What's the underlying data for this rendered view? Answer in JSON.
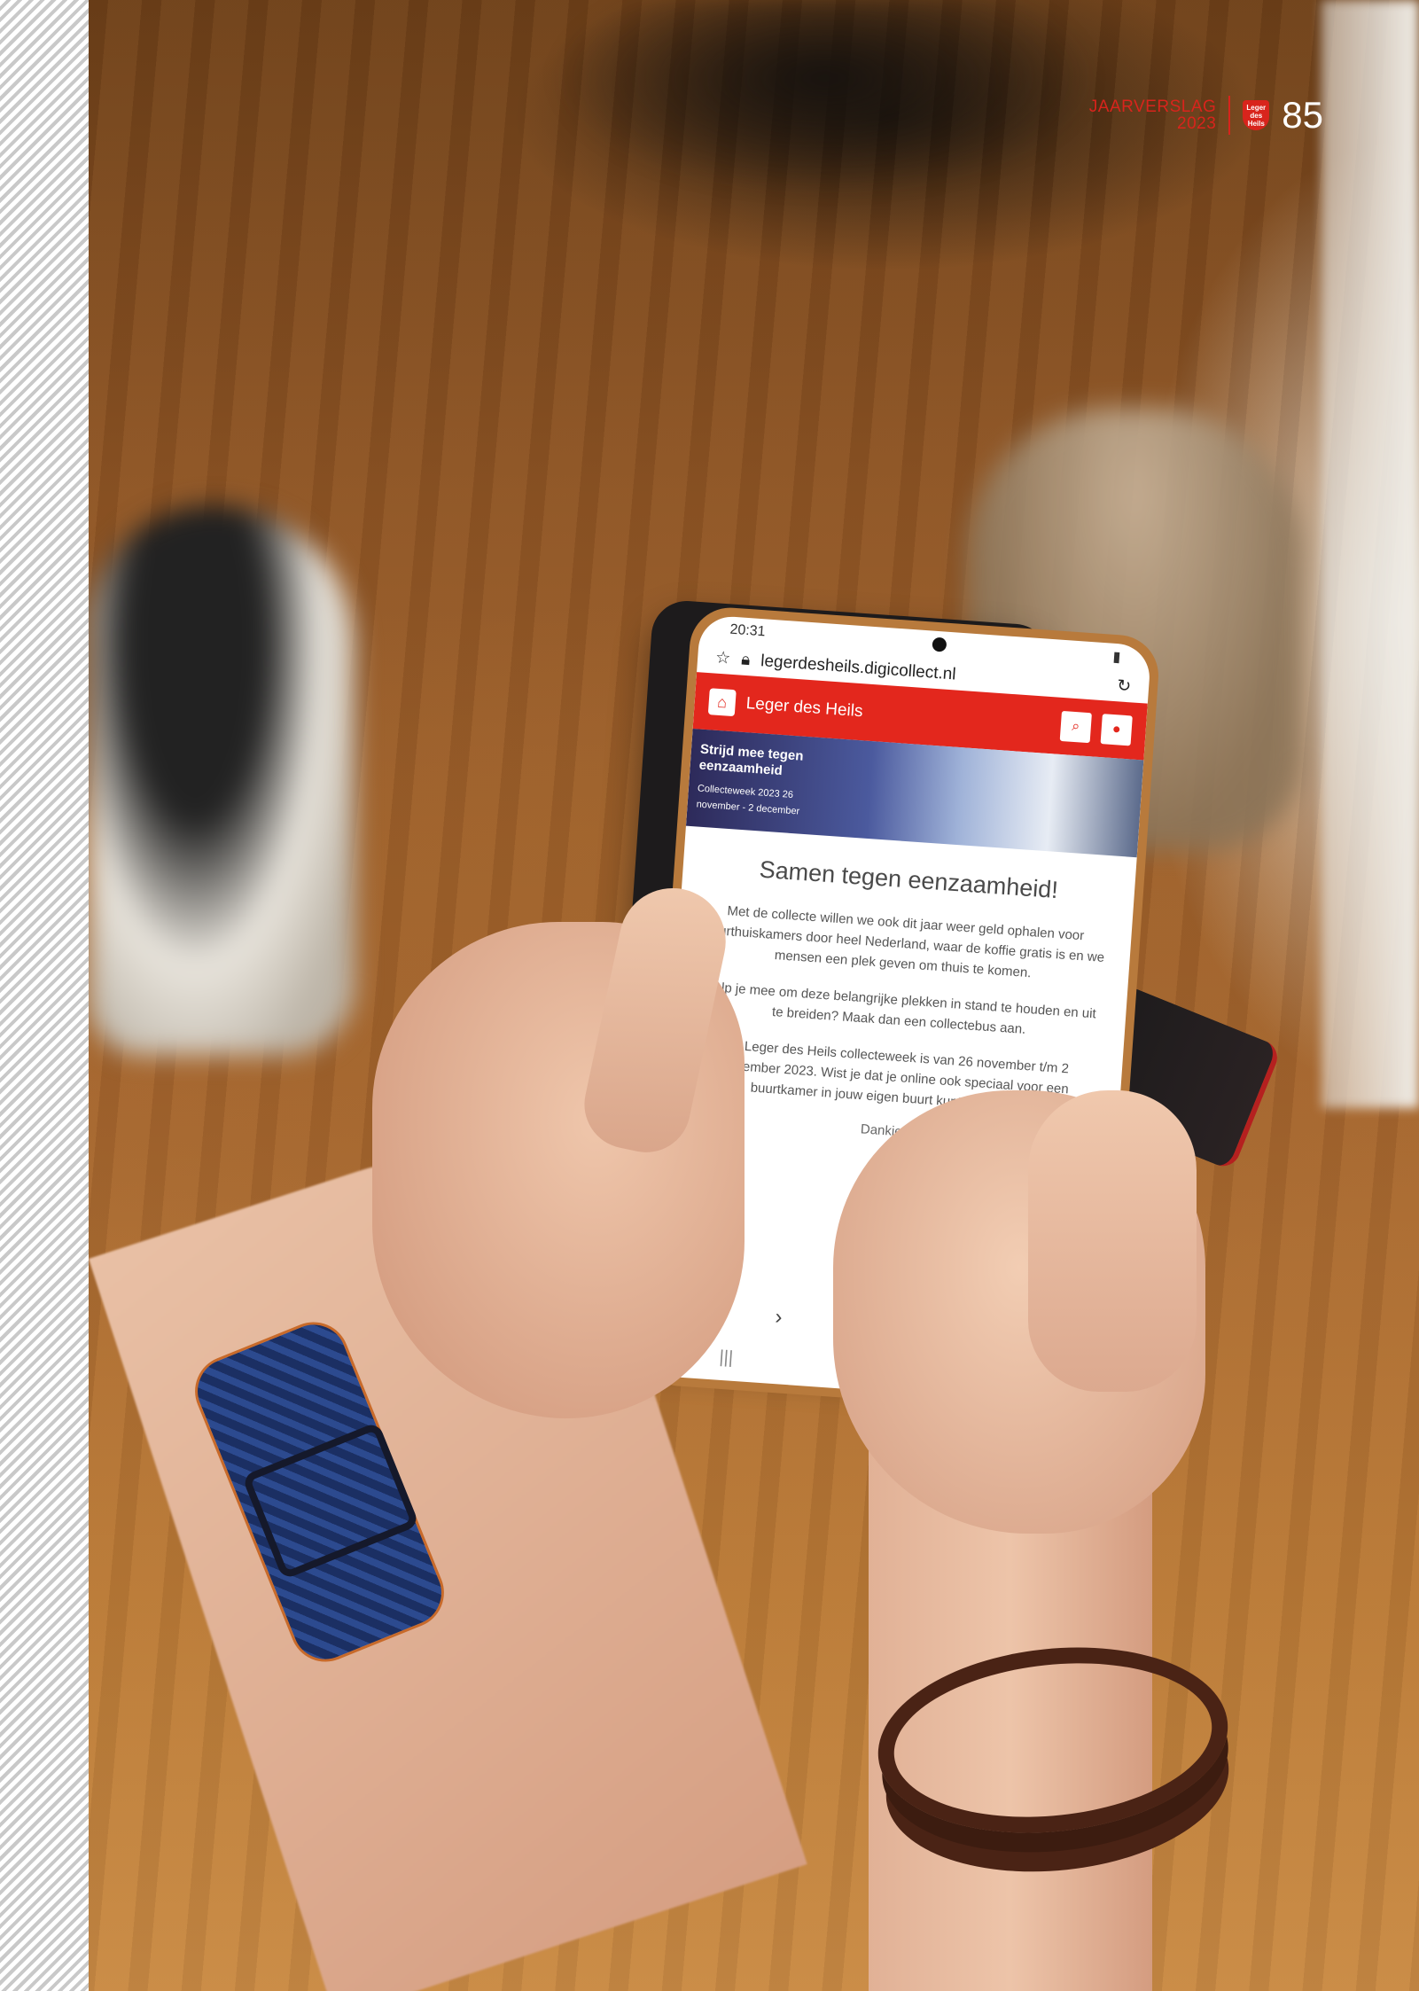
{
  "report": {
    "title_line1": "JAARVERSLAG",
    "title_line2": "2023",
    "page_number": "85",
    "logo_text": "Leger des Heils",
    "accent_color": "#d8241c"
  },
  "phone": {
    "status_time": "20:31",
    "url": "legerdesheils.digicollect.nl",
    "site_title": "Leger des Heils",
    "banner": {
      "headline": "Strijd mee tegen eenzaamheid",
      "subline": "Collecteweek 2023 26 november - 2 december"
    },
    "heading": "Samen tegen eenzaamheid!",
    "paragraphs": [
      "Met de collecte willen we ook dit jaar weer geld ophalen voor buurthuiskamers door heel Nederland, waar de koffie gratis is en we mensen een plek geven om thuis te komen.",
      "Help je mee om deze belangrijke plekken in stand te houden en uit te breiden? Maak dan een collectebus aan.",
      "De Leger des Heils collecteweek is van 26 november t/m 2 december 2023. Wist je dat je online ook speciaal voor een buurtkamer in jouw eigen buurt kunt collecteren?"
    ],
    "closing": "Dankjewel",
    "brand_color": "#e3271d"
  }
}
